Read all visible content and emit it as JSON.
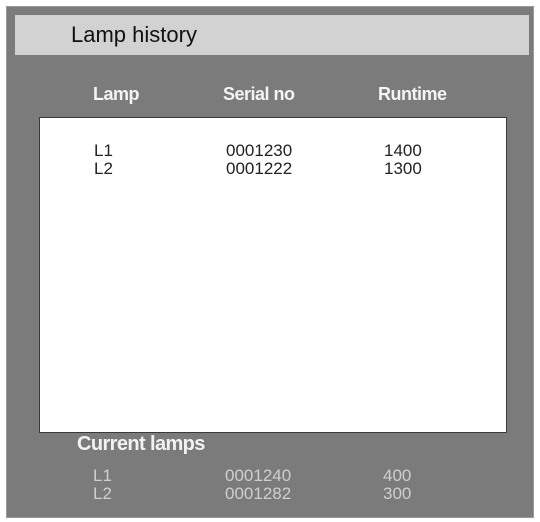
{
  "window": {
    "title": "Lamp history"
  },
  "columns": {
    "lamp": "Lamp",
    "serial": "Serial no",
    "runtime": "Runtime"
  },
  "history": [
    {
      "lamp": "L1",
      "serial": "0001230",
      "runtime": "1400"
    },
    {
      "lamp": "L2",
      "serial": "0001222",
      "runtime": "1300"
    }
  ],
  "current": {
    "title": "Current lamps",
    "rows": [
      {
        "lamp": "L1",
        "serial": "0001240",
        "runtime": "400"
      },
      {
        "lamp": "L2",
        "serial": "0001282",
        "runtime": "300"
      }
    ]
  }
}
